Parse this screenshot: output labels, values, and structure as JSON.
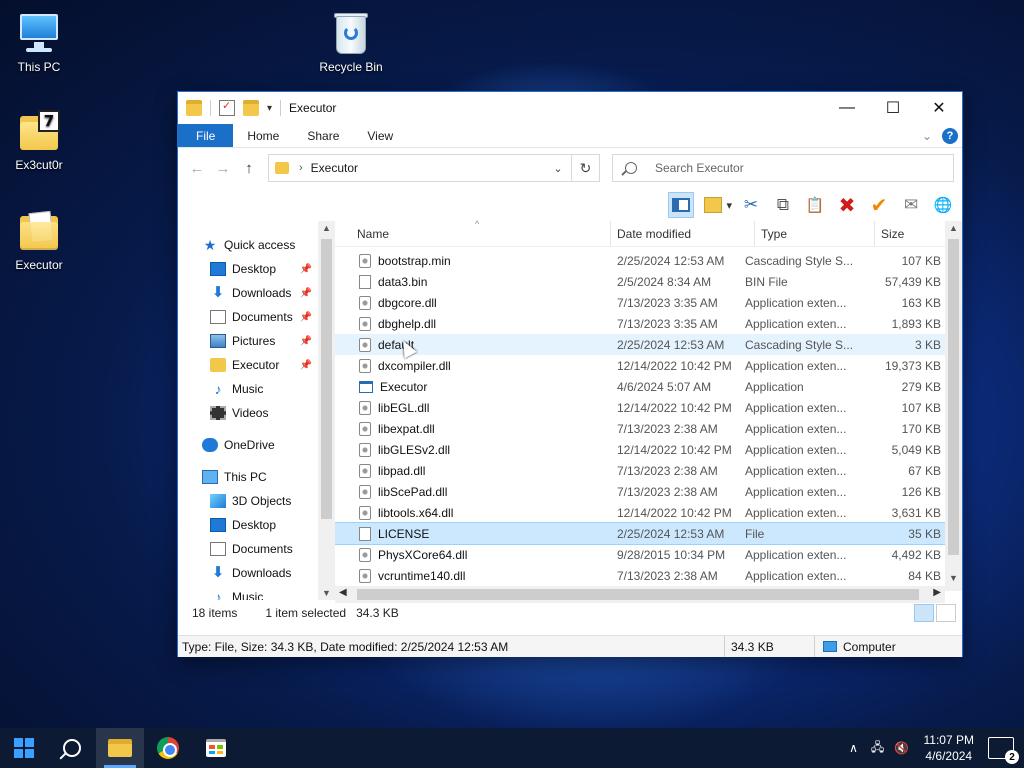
{
  "desktop": {
    "icons": [
      {
        "label": "This PC",
        "icon": "this-pc-icon"
      },
      {
        "label": "Recycle Bin",
        "icon": "recycle-bin-icon"
      },
      {
        "label": "Ex3cut0r",
        "icon": "folder-icon"
      },
      {
        "label": "Executor",
        "icon": "folder-icon"
      }
    ],
    "ex3cut0r_badge": "7"
  },
  "window": {
    "title": "Executor",
    "controls": {
      "minimize": "—",
      "maximize": "☐",
      "close": "✕"
    },
    "ribbon_tabs": [
      "File",
      "Home",
      "Share",
      "View"
    ],
    "ribbon_chevron": "⌄",
    "help": "?",
    "nav": {
      "back": "←",
      "forward": "→",
      "up": "↑"
    },
    "address": {
      "path": "Executor",
      "separator": "›",
      "dropdown": "⌄",
      "refresh": "↻"
    },
    "search": {
      "placeholder": "Search Executor"
    },
    "toolbar": {
      "cut": "✂",
      "copy": "⧉",
      "paste": "📋",
      "delete": "✖",
      "rename": "✔",
      "email": "✉",
      "globe": "🌐",
      "view_drop": "▾"
    },
    "navpane": {
      "items": [
        {
          "label": "Quick access",
          "icon": "star",
          "indent": 0,
          "pin": false
        },
        {
          "label": "Desktop",
          "icon": "desktop",
          "indent": 1,
          "pin": true
        },
        {
          "label": "Downloads",
          "icon": "download",
          "indent": 1,
          "pin": true
        },
        {
          "label": "Documents",
          "icon": "document",
          "indent": 1,
          "pin": true
        },
        {
          "label": "Pictures",
          "icon": "picture",
          "indent": 1,
          "pin": true
        },
        {
          "label": "Executor",
          "icon": "folder",
          "indent": 1,
          "pin": true
        },
        {
          "label": "Music",
          "icon": "music",
          "indent": 1,
          "pin": false
        },
        {
          "label": "Videos",
          "icon": "video",
          "indent": 1,
          "pin": false
        },
        {
          "label": "",
          "icon": "spacer",
          "indent": 0,
          "pin": false
        },
        {
          "label": "OneDrive",
          "icon": "cloud",
          "indent": 0,
          "pin": false
        },
        {
          "label": "",
          "icon": "spacer",
          "indent": 0,
          "pin": false
        },
        {
          "label": "This PC",
          "icon": "pc",
          "indent": 0,
          "pin": false
        },
        {
          "label": "3D Objects",
          "icon": "3d",
          "indent": 1,
          "pin": false
        },
        {
          "label": "Desktop",
          "icon": "desktop",
          "indent": 1,
          "pin": false
        },
        {
          "label": "Documents",
          "icon": "document",
          "indent": 1,
          "pin": false
        },
        {
          "label": "Downloads",
          "icon": "download",
          "indent": 1,
          "pin": false
        },
        {
          "label": "Music",
          "icon": "music",
          "indent": 1,
          "pin": false
        }
      ],
      "pin_glyph": "📌"
    },
    "columns": {
      "name": "Name",
      "date": "Date modified",
      "type": "Type",
      "size": "Size"
    },
    "files": [
      {
        "name": "bootstrap.min",
        "date": "2/25/2024 12:53 AM",
        "type": "Cascading Style S...",
        "size": "107 KB",
        "icon": "gear",
        "state": ""
      },
      {
        "name": "data3.bin",
        "date": "2/5/2024 8:34 AM",
        "type": "BIN File",
        "size": "57,439 KB",
        "icon": "file",
        "state": ""
      },
      {
        "name": "dbgcore.dll",
        "date": "7/13/2023 3:35 AM",
        "type": "Application exten...",
        "size": "163 KB",
        "icon": "gear",
        "state": ""
      },
      {
        "name": "dbghelp.dll",
        "date": "7/13/2023 3:35 AM",
        "type": "Application exten...",
        "size": "1,893 KB",
        "icon": "gear",
        "state": ""
      },
      {
        "name": "default",
        "date": "2/25/2024 12:53 AM",
        "type": "Cascading Style S...",
        "size": "3 KB",
        "icon": "gear",
        "state": "hover"
      },
      {
        "name": "dxcompiler.dll",
        "date": "12/14/2022 10:42 PM",
        "type": "Application exten...",
        "size": "19,373 KB",
        "icon": "gear",
        "state": ""
      },
      {
        "name": "Executor",
        "date": "4/6/2024 5:07 AM",
        "type": "Application",
        "size": "279 KB",
        "icon": "app",
        "state": ""
      },
      {
        "name": "libEGL.dll",
        "date": "12/14/2022 10:42 PM",
        "type": "Application exten...",
        "size": "107 KB",
        "icon": "gear",
        "state": ""
      },
      {
        "name": "libexpat.dll",
        "date": "7/13/2023 2:38 AM",
        "type": "Application exten...",
        "size": "170 KB",
        "icon": "gear",
        "state": ""
      },
      {
        "name": "libGLESv2.dll",
        "date": "12/14/2022 10:42 PM",
        "type": "Application exten...",
        "size": "5,049 KB",
        "icon": "gear",
        "state": ""
      },
      {
        "name": "libpad.dll",
        "date": "7/13/2023 2:38 AM",
        "type": "Application exten...",
        "size": "67 KB",
        "icon": "gear",
        "state": ""
      },
      {
        "name": "libScePad.dll",
        "date": "7/13/2023 2:38 AM",
        "type": "Application exten...",
        "size": "126 KB",
        "icon": "gear",
        "state": ""
      },
      {
        "name": "libtools.x64.dll",
        "date": "12/14/2022 10:42 PM",
        "type": "Application exten...",
        "size": "3,631 KB",
        "icon": "gear",
        "state": ""
      },
      {
        "name": "LICENSE",
        "date": "2/25/2024 12:53 AM",
        "type": "File",
        "size": "35 KB",
        "icon": "file",
        "state": "selected"
      },
      {
        "name": "PhysXCore64.dll",
        "date": "9/28/2015 10:34 PM",
        "type": "Application exten...",
        "size": "4,492 KB",
        "icon": "gear",
        "state": ""
      },
      {
        "name": "vcruntime140.dll",
        "date": "7/13/2023 2:38 AM",
        "type": "Application exten...",
        "size": "84 KB",
        "icon": "gear",
        "state": ""
      }
    ],
    "status": {
      "items": "18 items",
      "selected": "1 item selected",
      "selected_size": "34.3 KB"
    },
    "infobar": {
      "details": "Type: File, Size: 34.3 KB, Date modified: 2/25/2024 12:53 AM",
      "size": "34.3 KB",
      "location": "Computer"
    }
  },
  "taskbar": {
    "clock_time": "11:07 PM",
    "clock_date": "4/6/2024",
    "notification_count": "2",
    "tray": {
      "chevron": "∧",
      "network": "🖧",
      "volume": "🔇"
    }
  },
  "colors": {
    "accent": "#1a6fc9",
    "selected_row": "#cce8ff",
    "taskbar": "#0c1a33"
  }
}
